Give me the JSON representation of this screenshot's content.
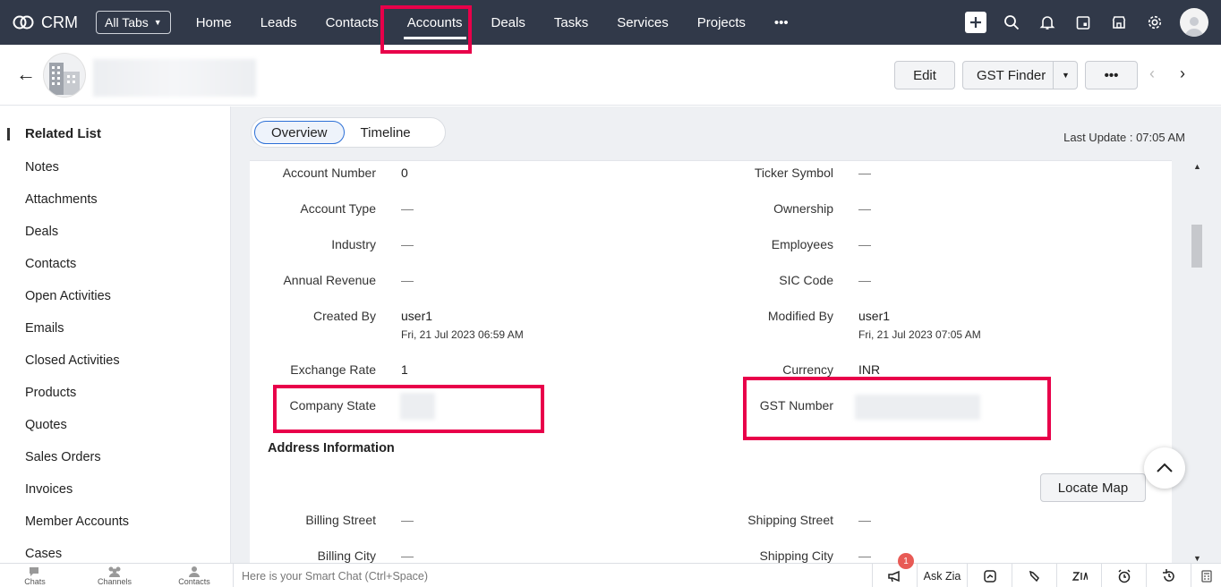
{
  "nav": {
    "brand": "CRM",
    "all_tabs": "All Tabs",
    "links": [
      "Home",
      "Leads",
      "Contacts",
      "Accounts",
      "Deals",
      "Tasks",
      "Services",
      "Projects"
    ],
    "more": "•••"
  },
  "header": {
    "edit": "Edit",
    "gst_finder": "GST Finder",
    "more": "•••"
  },
  "sidebar": {
    "title": "Related List",
    "items": [
      "Notes",
      "Attachments",
      "Deals",
      "Contacts",
      "Open Activities",
      "Emails",
      "Closed Activities",
      "Products",
      "Quotes",
      "Sales Orders",
      "Invoices",
      "Member Accounts",
      "Cases"
    ]
  },
  "tabs": {
    "overview": "Overview",
    "timeline": "Timeline"
  },
  "last_update": "Last Update : 07:05 AM",
  "fields_left": [
    {
      "label": "Account Number",
      "value": "0"
    },
    {
      "label": "Account Type",
      "value": "—"
    },
    {
      "label": "Industry",
      "value": "—"
    },
    {
      "label": "Annual Revenue",
      "value": "—"
    },
    {
      "label": "Created By",
      "value": "user1",
      "sub": "Fri, 21 Jul 2023 06:59 AM"
    },
    {
      "label": "Exchange Rate",
      "value": "1"
    },
    {
      "label": "Company State",
      "value": ""
    }
  ],
  "fields_right": [
    {
      "label": "Ticker Symbol",
      "value": "—"
    },
    {
      "label": "Ownership",
      "value": "—"
    },
    {
      "label": "Employees",
      "value": "—"
    },
    {
      "label": "SIC Code",
      "value": "—"
    },
    {
      "label": "Modified By",
      "value": "user1",
      "sub": "Fri, 21 Jul 2023 07:05 AM"
    },
    {
      "label": "Currency",
      "value": "INR"
    },
    {
      "label": "GST Number",
      "value": ""
    }
  ],
  "address": {
    "title": "Address Information",
    "locate_map": "Locate Map",
    "billing_street": "Billing Street",
    "billing_street_value": "—",
    "billing_city": "Billing City",
    "billing_city_value": "—",
    "shipping_street": "Shipping Street",
    "shipping_street_value": "—",
    "shipping_city": "Shipping City",
    "shipping_city_value": "—"
  },
  "bottom": {
    "chats": "Chats",
    "channels": "Channels",
    "contacts": "Contacts",
    "smart_chat_placeholder": "Here is your Smart Chat (Ctrl+Space)",
    "ask_zia": "Ask Zia",
    "notification_count": "1"
  },
  "colors": {
    "nav_bg": "#313949",
    "highlight": "#e8004a",
    "tab_active_border": "#2b6fd6"
  }
}
